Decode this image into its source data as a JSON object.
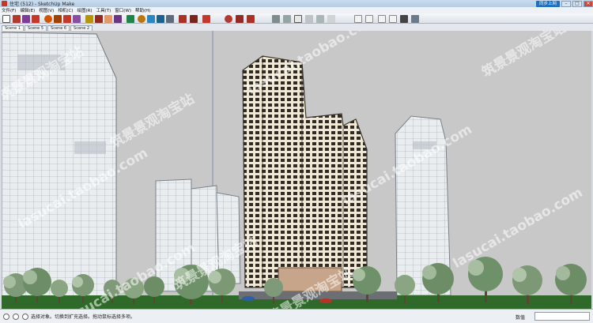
{
  "window": {
    "title": "住宅 (512) - SketchUp Make",
    "sync_button": "同步上网",
    "minimize": "–",
    "maximize": "□",
    "close": "✕"
  },
  "menu": [
    "文件(F)",
    "编辑(E)",
    "视图(V)",
    "相机(C)",
    "绘图(R)",
    "工具(T)",
    "窗口(W)",
    "帮助(H)"
  ],
  "toolbar": {
    "tools": [
      "select-tool",
      "line-tool",
      "arc-tool",
      "shape-tool",
      "push-pull-tool",
      "move-tool",
      "rotate-tool",
      "offset-tool",
      "tape-measure-tool",
      "paint-bucket-tool",
      "eraser-tool",
      "orbit-tool",
      "pan-tool",
      "zoom-tool",
      "zoom-extents-tool",
      "warehouse-tool",
      "extension-tool",
      "iso-view",
      "top-view",
      "front-view",
      "right-view",
      "back-view",
      "left-view",
      "xray-style",
      "wireframe-style",
      "hidden-line-style",
      "shaded-style",
      "textured-style",
      "monochrome-style"
    ]
  },
  "scenes": {
    "tabs": [
      "Scene 1",
      "Scene 5",
      "Scene 6",
      "Scene 2"
    ],
    "active_index": 0
  },
  "watermarks": [
    "筑景景观淘宝站",
    "lasucai.taobao.com",
    "筑景景观淘宝站",
    "lasucai.taobao.com",
    "lasucai.taobao.com",
    "筑景景观淘宝站",
    "lasucai.taobao.com",
    "筑景景观淘宝站",
    "lasucai.taobao.com",
    "筑景景观淘宝站"
  ],
  "status": {
    "message": "选择对象。切换到扩充选择。拖动鼠标选择多项。",
    "vcb_label": "数值",
    "vcb_value": ""
  },
  "colors": {
    "titlebar": "#c9dcef",
    "viewport_bg": "#c8c8c8",
    "ground": "#2f6a2a",
    "sync_button": "#1f6fbf"
  }
}
